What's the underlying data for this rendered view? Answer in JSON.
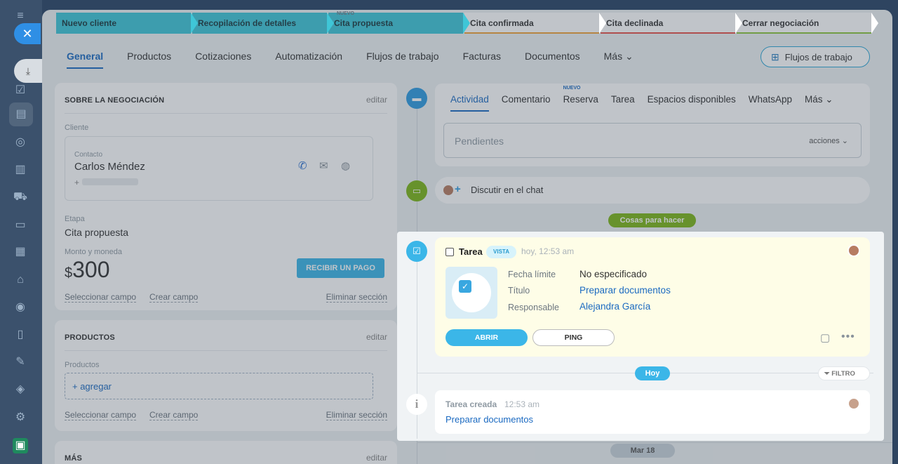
{
  "stages": [
    {
      "label": "Nuevo cliente",
      "done": true,
      "bar": ""
    },
    {
      "label": "Recopilación de detalles",
      "done": true,
      "bar": ""
    },
    {
      "label": "Cita propuesta",
      "done": true,
      "bar": "",
      "tag": "NUEVO"
    },
    {
      "label": "Cita confirmada",
      "done": false,
      "bar": "#f1a33a"
    },
    {
      "label": "Cita declinada",
      "done": false,
      "bar": "#e8534a"
    },
    {
      "label": "Cerrar negociación",
      "done": false,
      "bar": "#8dc63f"
    }
  ],
  "tabs": {
    "general": "General",
    "productos": "Productos",
    "cotizaciones": "Cotizaciones",
    "automatizacion": "Automatización",
    "flujos": "Flujos de trabajo",
    "facturas": "Facturas",
    "documentos": "Documentos",
    "mas": "Más"
  },
  "flows_button": "Flujos de trabajo",
  "about": {
    "title": "SOBRE LA NEGOCIACIÓN",
    "edit": "editar",
    "client_label": "Cliente",
    "contact_label": "Contacto",
    "contact_name": "Carlos Méndez",
    "phone_prefix": "+",
    "stage_label": "Etapa",
    "stage_value": "Cita propuesta",
    "amount_label": "Monto y moneda",
    "currency": "$",
    "amount": "300",
    "pay_button": "RECIBIR UN PAGO",
    "select_field": "Seleccionar campo",
    "create_field": "Crear campo",
    "delete_section": "Eliminar sección"
  },
  "products": {
    "title": "PRODUCTOS",
    "edit": "editar",
    "label": "Productos",
    "add": "+ agregar",
    "select_field": "Seleccionar campo",
    "create_field": "Crear campo",
    "delete_section": "Eliminar sección"
  },
  "more": {
    "title": "MÁS",
    "edit": "editar"
  },
  "activity": {
    "tabs": [
      "Actividad",
      "Comentario",
      "Reserva",
      "Tarea",
      "Espacios disponibles",
      "WhatsApp",
      "Más"
    ],
    "new_tag": "NUEVO",
    "pending_placeholder": "Pendientes",
    "actions": "acciones"
  },
  "chat": {
    "label": "Discutir en el chat"
  },
  "todo_pill": "Cosas para hacer",
  "task": {
    "title": "Tarea",
    "badge": "VISTA",
    "time": "hoy, 12:53 am",
    "deadline_label": "Fecha límite",
    "deadline_value": "No especificado",
    "title_label": "Título",
    "title_value": "Preparar documentos",
    "resp_label": "Responsable",
    "resp_value": "Alejandra García",
    "open": "ABRIR",
    "ping": "PING"
  },
  "today_pill": "Hoy",
  "filter": "FILTRO",
  "log": {
    "title": "Tarea creada",
    "time": "12:53 am",
    "link": "Preparar documentos"
  },
  "date_pill": "Mar 18"
}
